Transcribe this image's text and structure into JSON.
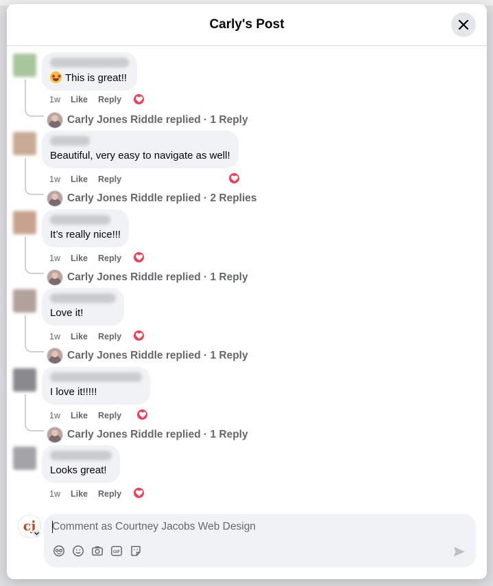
{
  "modal": {
    "title": "Carly's Post"
  },
  "colors": {
    "accent": "#f33e58",
    "bubble": "#f0f2f5",
    "secondary_text": "#65676b"
  },
  "comments": [
    {
      "text": "This is great!!",
      "emoji": "star-struck-emoji",
      "time": "1w",
      "like": "Like",
      "reply": "Reply",
      "reaction": "love",
      "replies_text": "Carly Jones Riddle replied · 1 Reply"
    },
    {
      "text": "Beautiful, very easy to navigate as well!",
      "time": "1w",
      "like": "Like",
      "reply": "Reply",
      "reaction": "love",
      "replies_text": "Carly Jones Riddle replied · 2 Replies"
    },
    {
      "text": "It’s really nice!!!",
      "time": "1w",
      "like": "Like",
      "reply": "Reply",
      "reaction": "love",
      "replies_text": "Carly Jones Riddle replied · 1 Reply"
    },
    {
      "text": "Love it!",
      "time": "1w",
      "like": "Like",
      "reply": "Reply",
      "reaction": "love",
      "replies_text": "Carly Jones Riddle replied · 1 Reply"
    },
    {
      "text": "I love it!!!!!",
      "time": "1w",
      "like": "Like",
      "reply": "Reply",
      "reaction": "love",
      "replies_text": "Carly Jones Riddle replied · 1 Reply"
    },
    {
      "text": "Looks great!",
      "time": "1w",
      "like": "Like",
      "reply": "Reply",
      "reaction": "love"
    }
  ],
  "composer": {
    "placeholder": "Comment as Courtney Jacobs Web Design",
    "avatar_initials": "cj",
    "tools": [
      "avatar-sticker-icon",
      "emoji-icon",
      "camera-icon",
      "gif-icon",
      "sticker-icon"
    ],
    "send_icon": "send-icon"
  }
}
